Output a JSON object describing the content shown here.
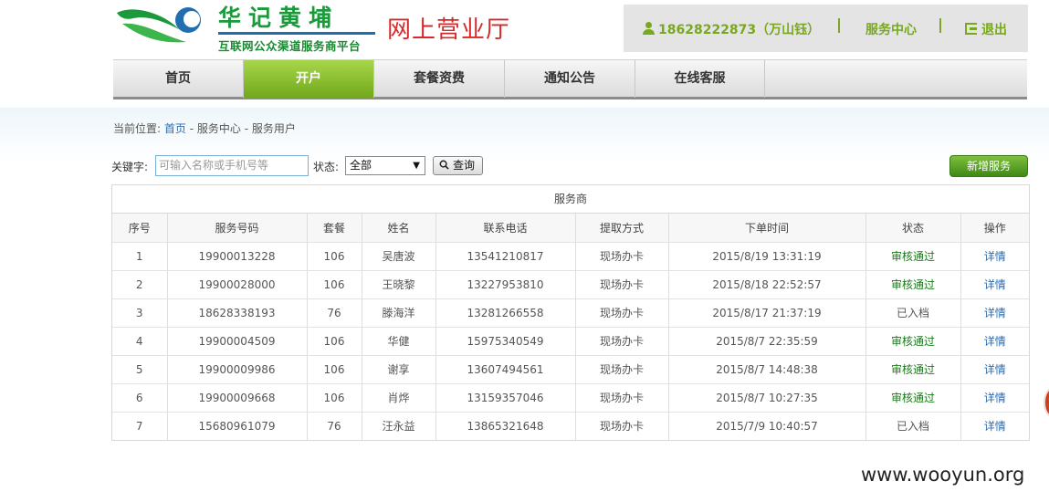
{
  "header": {
    "brand_name": "华记黄埔",
    "brand_subtitle": "互联网公众渠道服务商平台",
    "site_title": "网上营业厅",
    "user_label": "18628222873（万山钰）",
    "service_center": "服务中心",
    "logout": "退出",
    "colors": {
      "brand_green": "#1a9a3a",
      "title_red": "#d42a2a",
      "accent_green": "#78a81e"
    }
  },
  "nav": {
    "items": [
      {
        "label": "首页",
        "active": false
      },
      {
        "label": "开户",
        "active": true
      },
      {
        "label": "套餐资费",
        "active": false
      },
      {
        "label": "通知公告",
        "active": false
      },
      {
        "label": "在线客服",
        "active": false
      }
    ]
  },
  "breadcrumb": {
    "prefix": "当前位置:",
    "home": "首页",
    "sep1": " - ",
    "level2": "服务中心",
    "sep2": " - ",
    "level3": "服务用户"
  },
  "search": {
    "keyword_label": "关键字:",
    "keyword_placeholder": "可输入名称或手机号等",
    "status_label": "状态:",
    "status_selected": "全部",
    "query_button": "查询",
    "add_button": "新增服务"
  },
  "table": {
    "title": "服务商",
    "columns": [
      "序号",
      "服务号码",
      "套餐",
      "姓名",
      "联系电话",
      "提取方式",
      "下单时间",
      "状态",
      "操作"
    ],
    "rows": [
      [
        "1",
        "19900013228",
        "106",
        "吴唐波",
        "13541210817",
        "现场办卡",
        "2015/8/19 13:31:19",
        "审核通过",
        "详情"
      ],
      [
        "2",
        "19900028000",
        "106",
        "王晓黎",
        "13227953810",
        "现场办卡",
        "2015/8/18 22:52:57",
        "审核通过",
        "详情"
      ],
      [
        "3",
        "18628338193",
        "76",
        "滕海洋",
        "13281266558",
        "现场办卡",
        "2015/8/17 21:37:19",
        "已入档",
        "详情"
      ],
      [
        "4",
        "19900004509",
        "106",
        "华健",
        "15975340549",
        "现场办卡",
        "2015/8/7 22:35:59",
        "审核通过",
        "详情"
      ],
      [
        "5",
        "19900009986",
        "106",
        "谢享",
        "13607494561",
        "现场办卡",
        "2015/8/7 14:48:38",
        "审核通过",
        "详情"
      ],
      [
        "6",
        "19900009668",
        "106",
        "肖烨",
        "13159357046",
        "现场办卡",
        "2015/8/7 10:27:35",
        "审核通过",
        "详情"
      ],
      [
        "7",
        "15680961079",
        "76",
        "汪永益",
        "13865321648",
        "现场办卡",
        "2015/7/9 10:40:57",
        "已入档",
        "详情"
      ]
    ]
  },
  "watermark": "www.wooyun.org"
}
